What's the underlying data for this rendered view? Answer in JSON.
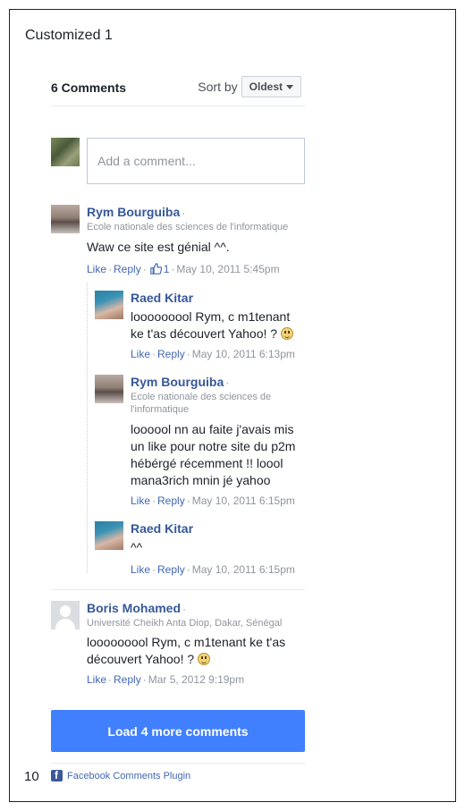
{
  "page": {
    "title": "Customized 1",
    "page_number": "10"
  },
  "header": {
    "count_label": "6 Comments",
    "sort_label": "Sort by",
    "sort_value": "Oldest"
  },
  "composer": {
    "placeholder": "Add a comment..."
  },
  "comments": [
    {
      "author": "Rym Bourguiba",
      "affiliation": "Ecole nationale des sciences de l'informatique",
      "text": "Waw ce site est génial ^^.",
      "like": "Like",
      "reply": "Reply",
      "like_count": "1",
      "timestamp": "May 10, 2011 5:45pm"
    },
    {
      "author": "Raed Kitar",
      "text": "looooooool Rym, c m1tenant ke t'as découvert Yahoo! ?",
      "like": "Like",
      "reply": "Reply",
      "timestamp": "May 10, 2011 6:13pm"
    },
    {
      "author": "Rym Bourguiba",
      "affiliation": "Ecole nationale des sciences de l'informatique",
      "text": "loooool nn au faite j'avais mis un like pour notre site du p2m hébérgé récemment !! loool mana3rich mnin jé yahoo",
      "like": "Like",
      "reply": "Reply",
      "timestamp": "May 10, 2011 6:15pm"
    },
    {
      "author": "Raed Kitar",
      "text": "^^",
      "like": "Like",
      "reply": "Reply",
      "timestamp": "May 10, 2011 6:15pm"
    },
    {
      "author": "Boris Mohamed",
      "affiliation": "Université Cheikh Anta Diop, Dakar, Sénégal",
      "text": "looooooool Rym, c m1tenant ke t'as découvert Yahoo! ?",
      "like": "Like",
      "reply": "Reply",
      "timestamp": "Mar 5, 2012 9:19pm"
    }
  ],
  "load_more": {
    "label": "Load 4 more comments"
  },
  "footer": {
    "plugin_label": "Facebook Comments Plugin"
  },
  "colors": {
    "link": "#365899",
    "button": "#4080ff",
    "meta": "#90949c"
  },
  "icons": [
    "like-thumb-icon",
    "smiley-icon",
    "facebook-icon",
    "chevron-down-icon"
  ]
}
